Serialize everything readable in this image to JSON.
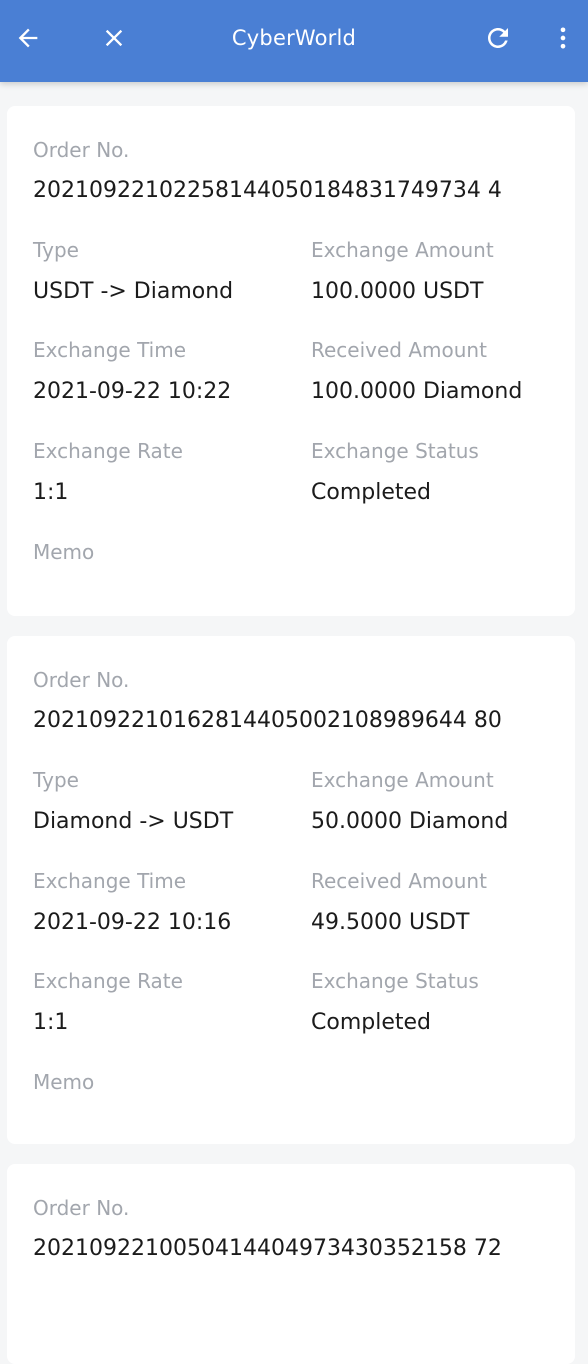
{
  "app": {
    "title": "CyberWorld"
  },
  "labels": {
    "order_no": "Order No.",
    "type": "Type",
    "exchange_amount": "Exchange Amount",
    "exchange_time": "Exchange Time",
    "received_amount": "Received Amount",
    "exchange_rate": "Exchange Rate",
    "exchange_status": "Exchange Status",
    "memo": "Memo"
  },
  "orders": [
    {
      "order_no": "20210922102258144050184831749734 4",
      "type": "USDT -> Diamond",
      "exchange_amount": "100.0000 USDT",
      "exchange_time": "2021-09-22 10:22",
      "received_amount": "100.0000 Diamond",
      "exchange_rate": "1:1",
      "exchange_status": "Completed",
      "memo": ""
    },
    {
      "order_no": "2021092210162814405002108989644 80",
      "type": "Diamond -> USDT",
      "exchange_amount": "50.0000 Diamond",
      "exchange_time": "2021-09-22 10:16",
      "received_amount": "49.5000 USDT",
      "exchange_rate": "1:1",
      "exchange_status": "Completed",
      "memo": ""
    },
    {
      "order_no": "2021092210050414404973430352158 72"
    }
  ]
}
